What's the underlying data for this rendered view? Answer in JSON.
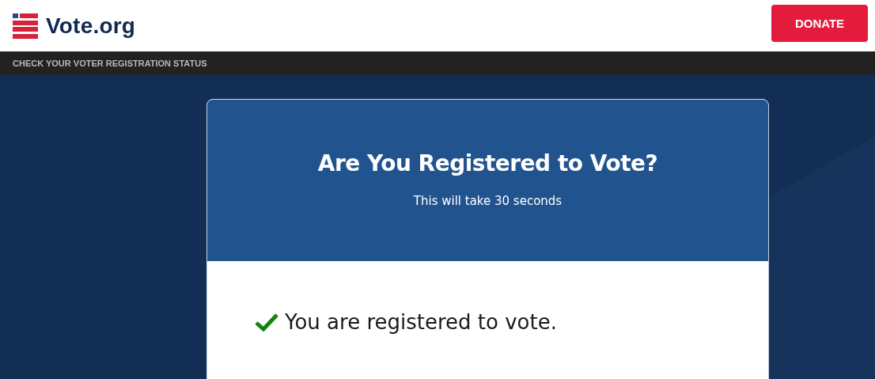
{
  "header": {
    "logo": "Vote.org",
    "donate_button": "DONATE"
  },
  "breadcrumb": "CHECK YOUR VOTER REGISTRATION STATUS",
  "card": {
    "title": "Are You Registered to Vote?",
    "subtitle": "This will take 30 seconds",
    "result": "You are registered to vote."
  }
}
